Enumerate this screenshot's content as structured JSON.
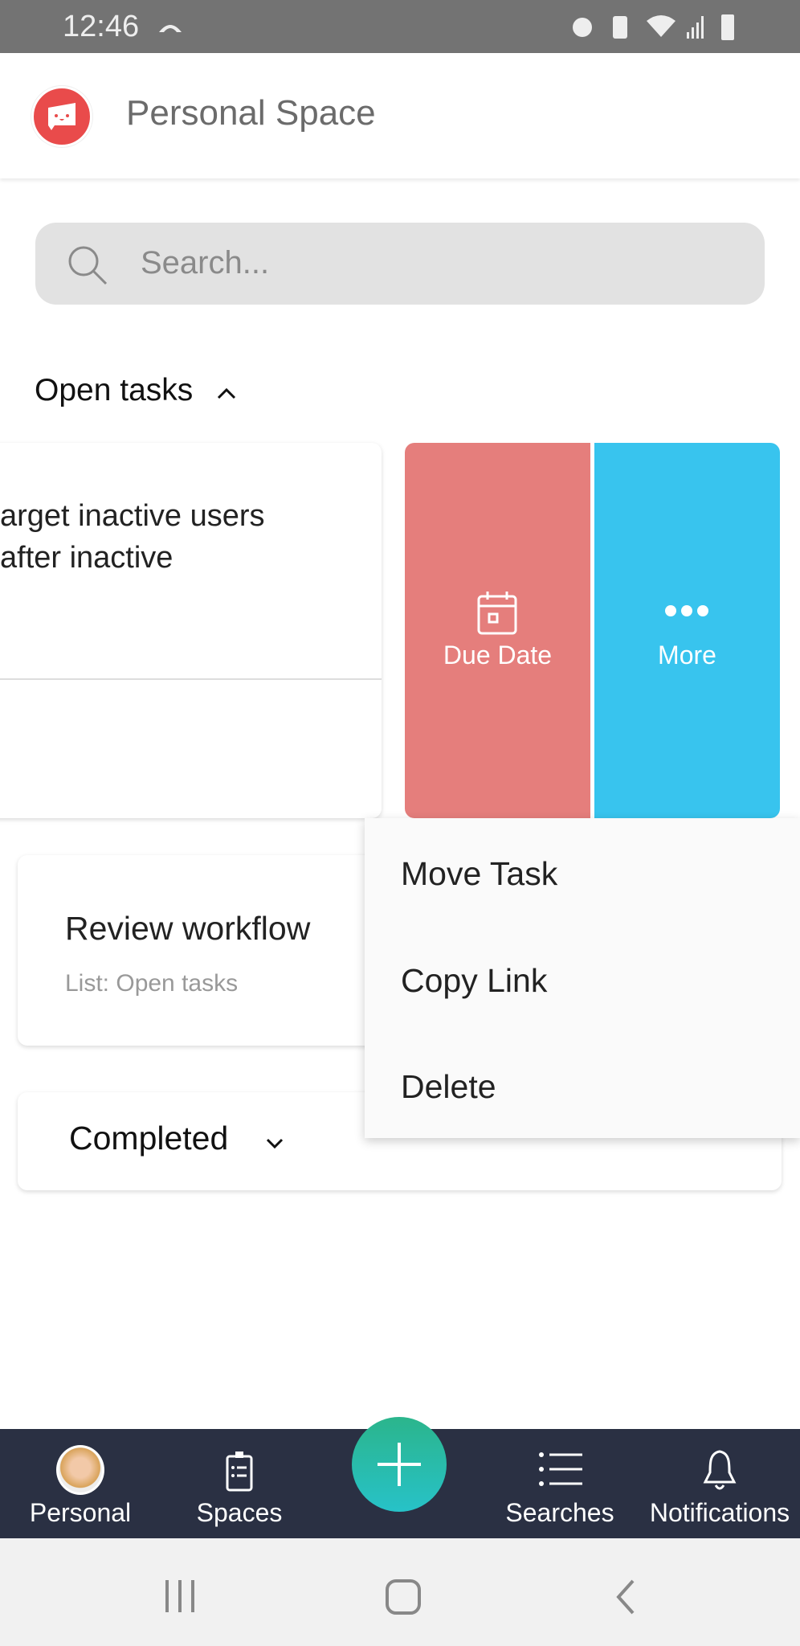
{
  "status_bar": {
    "time": "12:46"
  },
  "header": {
    "title": "Personal Space"
  },
  "search": {
    "placeholder": "Search..."
  },
  "open_tasks": {
    "label": "Open tasks"
  },
  "swiped_task": {
    "title_line1": "arget inactive users",
    "title_line2": "after  inactive"
  },
  "swipe_actions": {
    "due_date": "Due Date",
    "more": "More",
    "due_color": "#e57e7c",
    "more_color": "#38c4ee"
  },
  "context_menu": {
    "items": [
      "Move Task",
      "Copy Link",
      "Delete"
    ]
  },
  "task2": {
    "title": "Review workflow",
    "list": "List: Open tasks"
  },
  "completed": {
    "label": "Completed"
  },
  "bottom_nav": {
    "items": [
      "Personal",
      "Spaces",
      "Searches",
      "Notifications"
    ],
    "fab_color": "#2bb58c"
  }
}
